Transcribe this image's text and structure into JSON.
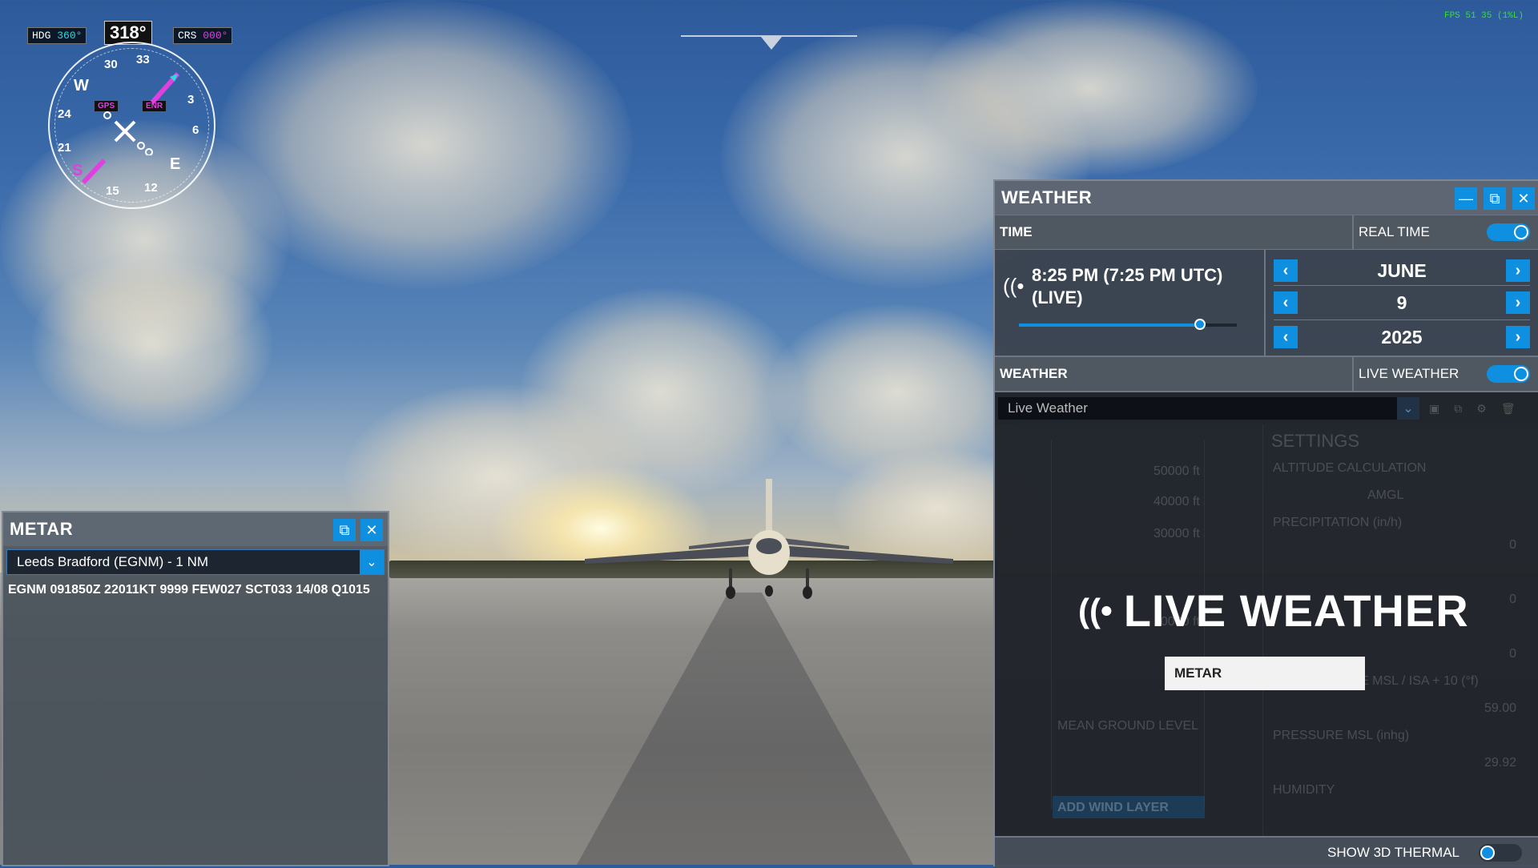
{
  "hud": {
    "hdg_label": "HDG",
    "hdg_value": "360°",
    "crs_label": "CRS",
    "crs_value": "000°",
    "heading_readout": "318°",
    "gps_label": "GPS",
    "enr_label": "ENR",
    "compass_labels": [
      "30",
      "33",
      "W",
      "24",
      "21",
      "S",
      "15",
      "12",
      "E",
      "6",
      "3"
    ],
    "fps_text": "FPS 51 35 (1%L)"
  },
  "metar_panel": {
    "title": "METAR",
    "station": "Leeds Bradford (EGNM) - 1 NM",
    "report": "EGNM 091850Z 22011KT 9999 FEW027 SCT033 14/08 Q1015"
  },
  "weather_panel": {
    "title": "WEATHER",
    "time_label": "TIME",
    "real_time_label": "REAL TIME",
    "real_time_on": true,
    "time_text": "8:25 PM (7:25 PM UTC) (LIVE)",
    "time_slider_fraction": 0.83,
    "month": "JUNE",
    "day": "9",
    "year": "2025",
    "weather_label": "WEATHER",
    "live_weather_label": "LIVE WEATHER",
    "live_weather_on": true,
    "preset": "Live Weather",
    "overlay_title": "LIVE WEATHER",
    "metar_button": "METAR",
    "dim": {
      "settings": "SETTINGS",
      "altitude_calc": "ALTITUDE CALCULATION",
      "amgl": "AMGL",
      "precipitation": "PRECIPITATION (in/h)",
      "temperature": "TEMPERATURE MSL / ISA + 10 (°f)",
      "pressure": "PRESSURE MSL (inhg)",
      "humidity": "HUMIDITY",
      "alt1": "50000 ft",
      "alt2": "40000 ft",
      "alt3": "30000 ft",
      "alt4": "10000 ft",
      "mean_ground": "MEAN GROUND LEVEL",
      "add_wind": "ADD WIND LAYER",
      "val_zero": "0",
      "val_temp": "59.00",
      "val_pressure": "29.92"
    },
    "show_3d_thermal_label": "SHOW 3D THERMAL",
    "show_3d_thermal_on": false
  }
}
